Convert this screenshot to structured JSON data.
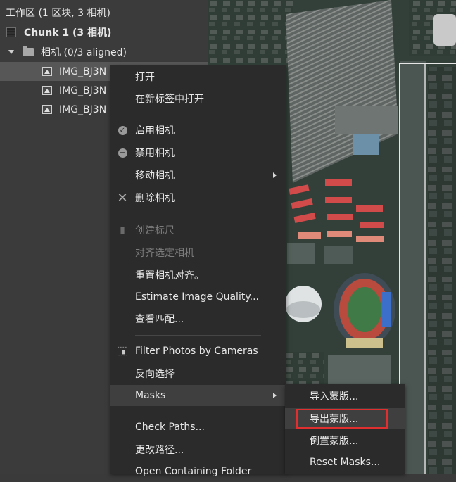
{
  "tree": {
    "workspace": "工作区 (1 区块, 3 相机)",
    "chunk": "Chunk 1 (3 相机)",
    "cameras_folder": "相机 (0/3 aligned)",
    "photos": [
      "IMG_BJ3N",
      "IMG_BJ3N",
      "IMG_BJ3N"
    ]
  },
  "context_menu": {
    "open": "打开",
    "open_new_tab": "在新标签中打开",
    "enable_cameras": "启用相机",
    "disable_cameras": "禁用相机",
    "move_cameras": "移动相机",
    "delete_cameras": "删除相机",
    "create_scale_bar": "创建标尺",
    "align_selected": "对齐选定相机",
    "reset_alignment": "重置相机对齐。",
    "estimate_quality": "Estimate Image Quality...",
    "view_matches": "查看匹配...",
    "filter_photos": "Filter Photos by Cameras",
    "invert_selection": "反向选择",
    "masks": "Masks",
    "check_paths": "Check Paths...",
    "change_path": "更改路径...",
    "open_folder": "Open Containing Folder"
  },
  "masks_submenu": {
    "import": "导入蒙版...",
    "export": "导出蒙版...",
    "invert": "倒置蒙版...",
    "reset": "Reset Masks..."
  },
  "colors": {
    "menu_bg": "#2b2b2b",
    "highlight_box": "#e02f2f"
  }
}
